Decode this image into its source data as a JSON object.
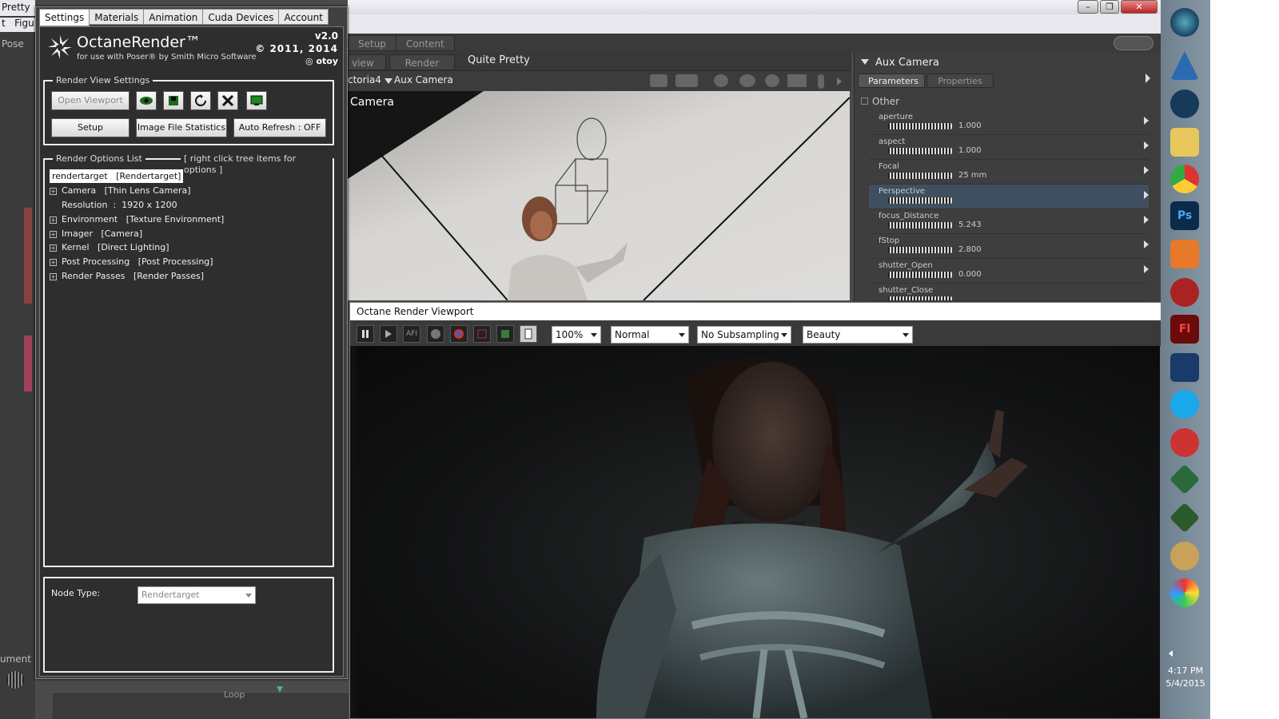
{
  "poser": {
    "window_title": "Pretty -",
    "menu_frag": "t   Figu",
    "left_labels": [
      "Pose",
      "ument"
    ],
    "tabs": [
      "Setup",
      "Content"
    ],
    "doc_tabs": [
      "view",
      "Render"
    ],
    "doc_name": "Quite Pretty",
    "figure": "ctoria4",
    "camera_select": "Aux Camera",
    "viewport_label": "Camera",
    "bottom_frag": "Loop"
  },
  "params": {
    "header": "Aux Camera",
    "tabs": [
      "Parameters",
      "Properties"
    ],
    "group": "Other",
    "rows": [
      {
        "name": "aperture",
        "value": "1.000"
      },
      {
        "name": "aspect",
        "value": "1.000"
      },
      {
        "name": "Focal",
        "value": "25 mm"
      },
      {
        "name": "Perspective",
        "value": ""
      },
      {
        "name": "focus_Distance",
        "value": "5.243"
      },
      {
        "name": "fStop",
        "value": "2.800"
      },
      {
        "name": "shutter_Open",
        "value": "0.000"
      },
      {
        "name": "shutter_Close",
        "value": ""
      }
    ]
  },
  "octane": {
    "tabs": [
      "Settings",
      "Materials",
      "Animation",
      "Cuda Devices",
      "Account"
    ],
    "brand": "OctaneRender™",
    "subtitle": "for use with Poser® by Smith Micro Software",
    "version": "v2.0",
    "copyright": "2011, 2014",
    "otoy": "otoy",
    "render_view_settings": "Render View Settings",
    "open_viewport": "Open Viewport",
    "setup": "Setup",
    "image_stats": "Image File Statistics",
    "auto_refresh": "Auto Refresh : OFF",
    "render_options": "Render Options List",
    "right_click_hint": "[ right click tree items for options ]",
    "tree_root": "rendertarget   [Rendertarget]",
    "tree": [
      {
        "label": "Camera   [Thin Lens Camera]",
        "expandable": true
      },
      {
        "label": "Resolution  :  1920 x 1200",
        "expandable": false
      },
      {
        "label": "Environment   [Texture Environment]",
        "expandable": true
      },
      {
        "label": "Imager   [Camera]",
        "expandable": true
      },
      {
        "label": "Kernel   [Direct Lighting]",
        "expandable": true
      },
      {
        "label": "Post Processing   [Post Processing]",
        "expandable": true
      },
      {
        "label": "Render Passes   [Render Passes]",
        "expandable": true
      }
    ],
    "node_type_label": "Node Type:",
    "node_type_value": "Rendertarget"
  },
  "viewport": {
    "title": "Octane Render Viewport",
    "zoom": "100%",
    "mode": "Normal",
    "subsampling": "No Subsampling",
    "pass": "Beauty",
    "afi_label": "AFI"
  },
  "taskbar": {
    "time": "4:17 PM",
    "date": "5/4/2015",
    "icons": [
      "windows-start-icon",
      "sketch-app-icon",
      "steam-icon",
      "file-explorer-icon",
      "chrome-icon",
      "photoshop-icon",
      "media-player-icon",
      "red-app-icon",
      "flash-icon",
      "blue-app-icon",
      "skype-icon",
      "shield-app-icon",
      "excel-red-icon",
      "excel-icon",
      "monkey-app-icon",
      "paint-icon"
    ]
  }
}
